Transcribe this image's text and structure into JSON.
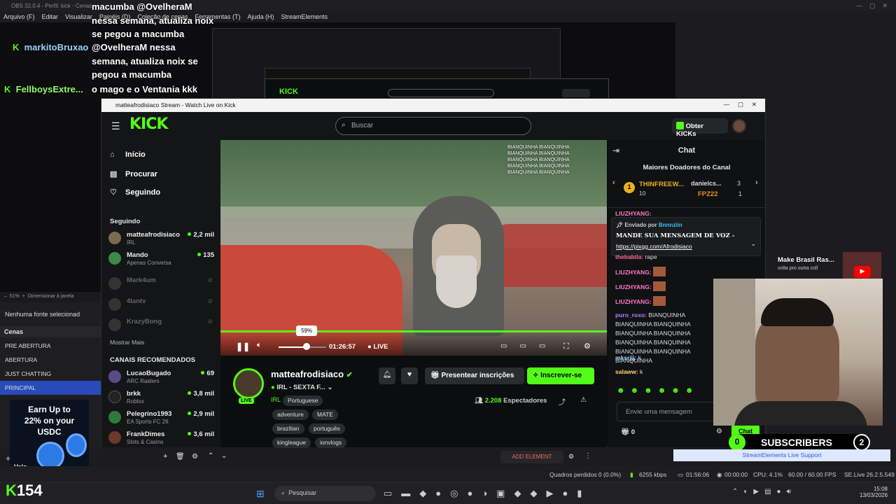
{
  "obs": {
    "title": "OBS 32.0.4 - Perfil: kick - Cenas:",
    "menu": [
      "Arquivo (F)",
      "Editar",
      "Visualizar",
      "Painéis (D)",
      "Coleção de cenas",
      "Ferramentas (T)",
      "Ajuda (H)",
      "StreamElements"
    ],
    "zoom": "51%",
    "zoom_label": "Dimensionar à janela",
    "sources_empty": "Nenhuma fonte selecionad",
    "scenes_header": "Cenas",
    "scenes": [
      "PRE ABERTURA",
      "ABERTURA",
      "JUST CHATTING",
      "PRINCIPAL"
    ],
    "add_element": "ADD ELEMENT",
    "status": {
      "frames_lost": "Quadros perdidos 0 (0.0%)",
      "kbps": "6255 kbps",
      "live_time": "01:56:06",
      "rec_time": "00:00:00",
      "cpu": "CPU: 4.1%",
      "fps": "60.00 / 60.00 FPS",
      "version": "SE.Live 26.2.5.549"
    }
  },
  "overlay_chat": [
    {
      "user": "",
      "text": "macumba @OvelheraM nessa semana, atualiza noix se pegou a macumba"
    },
    {
      "user": "markitoBruxao",
      "text": "@OvelheraM nessa semana, atualiza noix se pegou a macumba"
    },
    {
      "user": "FellboysExtre...",
      "text": "o mago e o Ventania kkk"
    }
  ],
  "kick": {
    "window_title": "matteafrodisiaco Stream - Watch Live on Kick",
    "logo": "KICK",
    "search_placeholder": "Buscar",
    "get_kicks": "Obter KICKs",
    "nav": [
      "Início",
      "Procurar",
      "Seguindo"
    ],
    "following_header": "Seguindo",
    "following": [
      {
        "name": "matteafrodisiaco",
        "sub": "IRL",
        "viewers": "2,2 mil"
      },
      {
        "name": "Mando",
        "sub": "Apenas Conversa",
        "viewers": "135"
      },
      {
        "name": "Mark4um",
        "sub": "",
        "viewers": ""
      },
      {
        "name": "4lantv",
        "sub": "",
        "viewers": ""
      },
      {
        "name": "KrazyBong",
        "sub": "",
        "viewers": ""
      }
    ],
    "show_more": "Mostrar Mais",
    "recommended_header": "CANAIS RECOMENDADOS",
    "recommended": [
      {
        "name": "LucaoBugado",
        "sub": "ARC Raiders",
        "viewers": "69"
      },
      {
        "name": "brkk",
        "sub": "Roblox",
        "viewers": "3,8 mil"
      },
      {
        "name": "Pelegrino1993",
        "sub": "EA Sports FC 26",
        "viewers": "2,9 mil"
      },
      {
        "name": "FrankDimes",
        "sub": "Slots & Casino",
        "viewers": "3,6 mil"
      }
    ],
    "player": {
      "volume": "59%",
      "volume_fraction": 0.59,
      "time": "01:26:57",
      "live": "LIVE"
    },
    "channel": {
      "name": "matteafrodisiaco",
      "title": "IRL - SEXTA F...",
      "category": "IRL",
      "language": "Portuguese",
      "tags": [
        "adventure",
        "MATE",
        "brazilian",
        "português",
        "kingleague",
        "ionvlogs"
      ],
      "gift_label": "Presentear inscrições",
      "subscribe_label": "Inscrever-se",
      "viewers": "2.208",
      "viewers_label": "Espectadores",
      "live_badge": "LIVE"
    },
    "chat": {
      "title": "Chat",
      "top_donors": "Maiores Doadores do Canal",
      "donors": [
        {
          "name": "THINFREEW...",
          "value": "10"
        },
        {
          "name": "danielcs...",
          "value": "3"
        },
        {
          "name": "FPZ22",
          "value": "1"
        }
      ],
      "pinned_by_label": "Enviado por",
      "pinned_by": "Bnnnziin",
      "pinned_text": "MANDE SUA MENSAGEM DE VOZ -",
      "pinned_link": "https://pixgg.com/Afrodisiaco",
      "messages": [
        {
          "user": "LIUZHYANG:",
          "text": ""
        },
        {
          "user": "thebabila:",
          "text": "rape"
        },
        {
          "user": "LIUZHYANG:",
          "text": ""
        },
        {
          "user": "LIUZHYANG:",
          "text": ""
        },
        {
          "user": "LIUZHYANG:",
          "text": ""
        },
        {
          "user": "puro_roxo:",
          "text": "BIANQUINHA BIANQUINHA BIANQUINHA BIANQUINHA BIANQUINHA BIANQUINHA BIANQUINHA BIANQUINHA BIANQUINHA BIANQUINHA"
        },
        {
          "user": "mksrjjj:",
          "text": "k"
        },
        {
          "user": "salaww:",
          "text": "k"
        }
      ],
      "input_placeholder": "Envie uma mensagem",
      "kicks": "0",
      "send_label": "Chat"
    }
  },
  "widgets": {
    "subscribers_label": "SUBSCRIBERS",
    "subscribers_left": "0",
    "subscribers_right": "2",
    "se_support": "StreamElements Live Support",
    "yt_title": "Make Brasil Ras...",
    "yt_sub": "volta pro outra coll",
    "kick_count": "154",
    "ad_text": "Earn Up to 22% on your USDC",
    "ad_brand": "Valo"
  },
  "taskbar": {
    "search": "Pesquisar",
    "time": "15:08",
    "date": "13/03/2026"
  }
}
